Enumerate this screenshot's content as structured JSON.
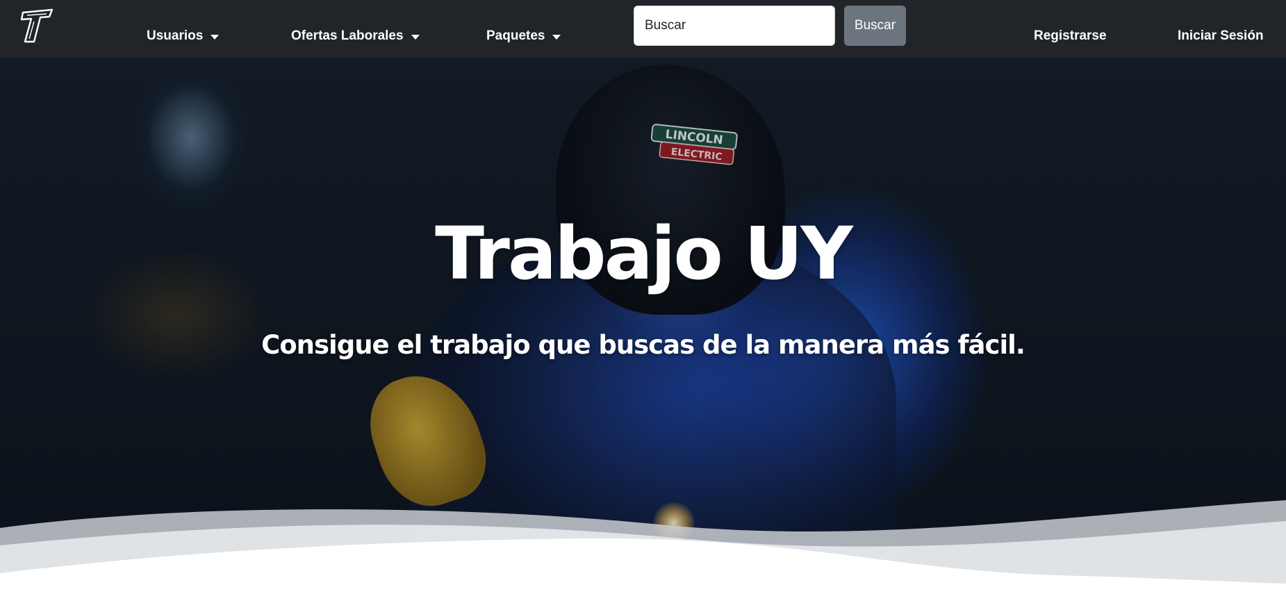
{
  "navbar": {
    "logo_name": "trabajo-uy-logo",
    "menus": [
      {
        "label": "Usuarios",
        "icon": "chevron-down-icon"
      },
      {
        "label": "Ofertas Laborales",
        "icon": "chevron-down-icon"
      },
      {
        "label": "Paquetes",
        "icon": "chevron-down-icon"
      }
    ],
    "search": {
      "placeholder": "Buscar",
      "value": "",
      "button_label": "Buscar"
    },
    "auth": {
      "register_label": "Registrarse",
      "login_label": "Iniciar Sesión"
    }
  },
  "hero": {
    "title": "Trabajo UY",
    "subtitle": "Consigue el trabajo que buscas de la manera más fácil.",
    "background_image": "welder-with-sparks-photo",
    "helmet_badge": {
      "line1": "LINCOLN",
      "line2": "ELECTRIC"
    }
  },
  "colors": {
    "navbar_bg": "#212529",
    "search_button_bg": "#6c757d",
    "text_light": "#ffffff"
  }
}
